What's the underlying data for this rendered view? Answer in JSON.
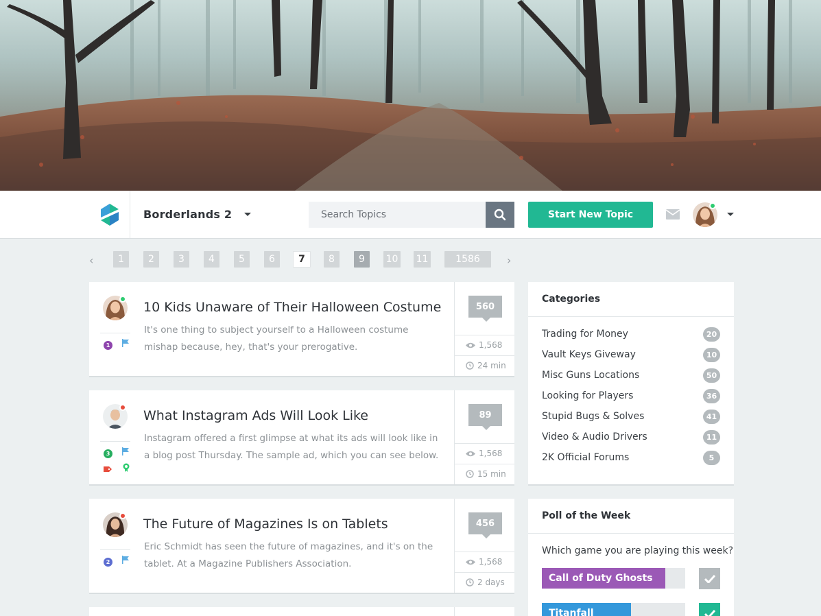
{
  "header": {
    "forum_name": "Borderlands 2",
    "search_placeholder": "Search Topics",
    "new_topic_label": "Start New Topic"
  },
  "pagination": {
    "pages": [
      "1",
      "2",
      "3",
      "4",
      "5",
      "6",
      "7",
      "8",
      "9",
      "10",
      "11",
      "1586"
    ],
    "current": "7"
  },
  "topics": [
    {
      "title": "10 Kids Unaware of Their Halloween Costume",
      "excerpt": "It's one thing to subject yourself to a Halloween costume mishap because, hey, that's your prerogative.",
      "replies": "560",
      "views": "1,568",
      "time": "24 min",
      "badge": "1",
      "status_color": "#2ecc71",
      "badge_color": "#8e44ad"
    },
    {
      "title": "What Instagram Ads Will Look Like",
      "excerpt": "Instagram offered a first glimpse at what its ads will look like in a blog post Thursday. The sample ad, which you can see below.",
      "replies": "89",
      "views": "1,568",
      "time": "15 min",
      "badge": "3",
      "status_color": "#e74c3c",
      "badge_color": "#27ae60"
    },
    {
      "title": "The Future of Magazines Is on Tablets",
      "excerpt": "Eric Schmidt has seen the future of magazines, and it's on the tablet. At a Magazine Publishers Association.",
      "replies": "456",
      "views": "1,568",
      "time": "2 days",
      "badge": "2",
      "status_color": "#e74c3c",
      "badge_color": "#5d6ed1"
    }
  ],
  "categories": {
    "title": "Categories",
    "items": [
      {
        "name": "Trading for Money",
        "count": "20"
      },
      {
        "name": "Vault Keys Giveway",
        "count": "10"
      },
      {
        "name": "Misc Guns Locations",
        "count": "50"
      },
      {
        "name": "Looking for Players",
        "count": "36"
      },
      {
        "name": "Stupid Bugs & Solves",
        "count": "41"
      },
      {
        "name": "Video & Audio Drivers",
        "count": "11"
      },
      {
        "name": "2K Official Forums",
        "count": "5"
      }
    ]
  },
  "poll": {
    "title": "Poll of the Week",
    "question": "Which game you are playing this week?",
    "options": [
      {
        "label": "Call of Duty Ghosts",
        "fraction": 0.86,
        "color": "#9b59b6",
        "check_color": "#b4babd"
      },
      {
        "label": "Titanfall",
        "fraction": 0.62,
        "color": "#3498db",
        "check_color": "#21b893"
      }
    ]
  },
  "icons": {
    "logo": "logo-icon",
    "search": "search-icon",
    "mail": "mail-icon",
    "eye": "eye-icon",
    "clock": "clock-icon",
    "flag": "flag-icon",
    "tag": "tag-icon",
    "award": "award-icon",
    "check": "check-icon"
  }
}
